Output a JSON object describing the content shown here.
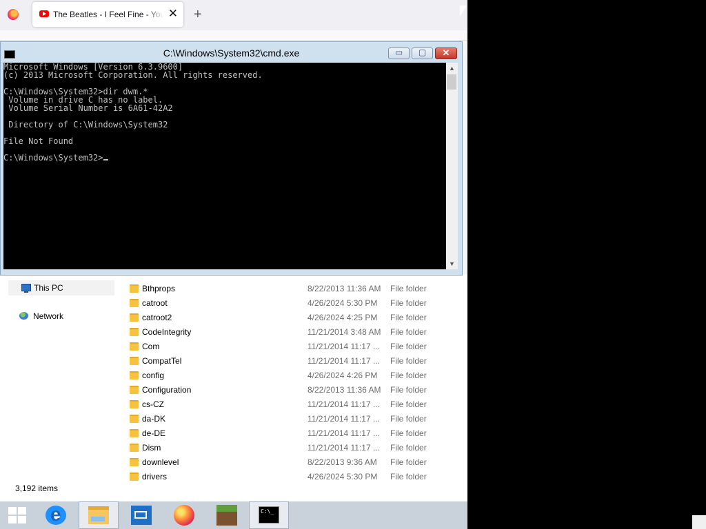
{
  "browser": {
    "tab_title": "The Beatles - I Feel Fine - YouTube",
    "close_glyph": "✕",
    "new_tab_glyph": "+"
  },
  "cmd": {
    "title": "C:\\Windows\\System32\\cmd.exe",
    "lines": [
      "Microsoft Windows [Version 6.3.9600]",
      "(c) 2013 Microsoft Corporation. All rights reserved.",
      "",
      "C:\\Windows\\System32>dir dwm.*",
      " Volume in drive C has no label.",
      " Volume Serial Number is 6A61-42A2",
      "",
      " Directory of C:\\Windows\\System32",
      "",
      "File Not Found",
      "",
      "C:\\Windows\\System32>"
    ],
    "minimize_glyph": "▭",
    "maximize_glyph": "▢",
    "close_glyph": "✕"
  },
  "explorer": {
    "nav": [
      {
        "label": "This PC",
        "icon": "computer-icon"
      },
      {
        "label": "Network",
        "icon": "network-icon"
      }
    ],
    "files": [
      {
        "name": "Bthprops",
        "date": "8/22/2013 11:36 AM",
        "type": "File folder"
      },
      {
        "name": "catroot",
        "date": "4/26/2024 5:30 PM",
        "type": "File folder"
      },
      {
        "name": "catroot2",
        "date": "4/26/2024 4:25 PM",
        "type": "File folder"
      },
      {
        "name": "CodeIntegrity",
        "date": "11/21/2014 3:48 AM",
        "type": "File folder"
      },
      {
        "name": "Com",
        "date": "11/21/2014 11:17 ...",
        "type": "File folder"
      },
      {
        "name": "CompatTel",
        "date": "11/21/2014 11:17 ...",
        "type": "File folder"
      },
      {
        "name": "config",
        "date": "4/26/2024 4:26 PM",
        "type": "File folder"
      },
      {
        "name": "Configuration",
        "date": "8/22/2013 11:36 AM",
        "type": "File folder"
      },
      {
        "name": "cs-CZ",
        "date": "11/21/2014 11:17 ...",
        "type": "File folder"
      },
      {
        "name": "da-DK",
        "date": "11/21/2014 11:17 ...",
        "type": "File folder"
      },
      {
        "name": "de-DE",
        "date": "11/21/2014 11:17 ...",
        "type": "File folder"
      },
      {
        "name": "Dism",
        "date": "11/21/2014 11:17 ...",
        "type": "File folder"
      },
      {
        "name": "downlevel",
        "date": "8/22/2013 9:36 AM",
        "type": "File folder"
      },
      {
        "name": "drivers",
        "date": "4/26/2024 5:30 PM",
        "type": "File folder"
      }
    ],
    "status": "3,192 items"
  },
  "taskbar": {
    "items": [
      "start-icon",
      "internet-explorer-icon",
      "file-explorer-icon",
      "mail-icon",
      "firefox-icon",
      "minecraft-icon",
      "command-prompt-icon"
    ],
    "cmd_icon_text": "C:\\_"
  }
}
